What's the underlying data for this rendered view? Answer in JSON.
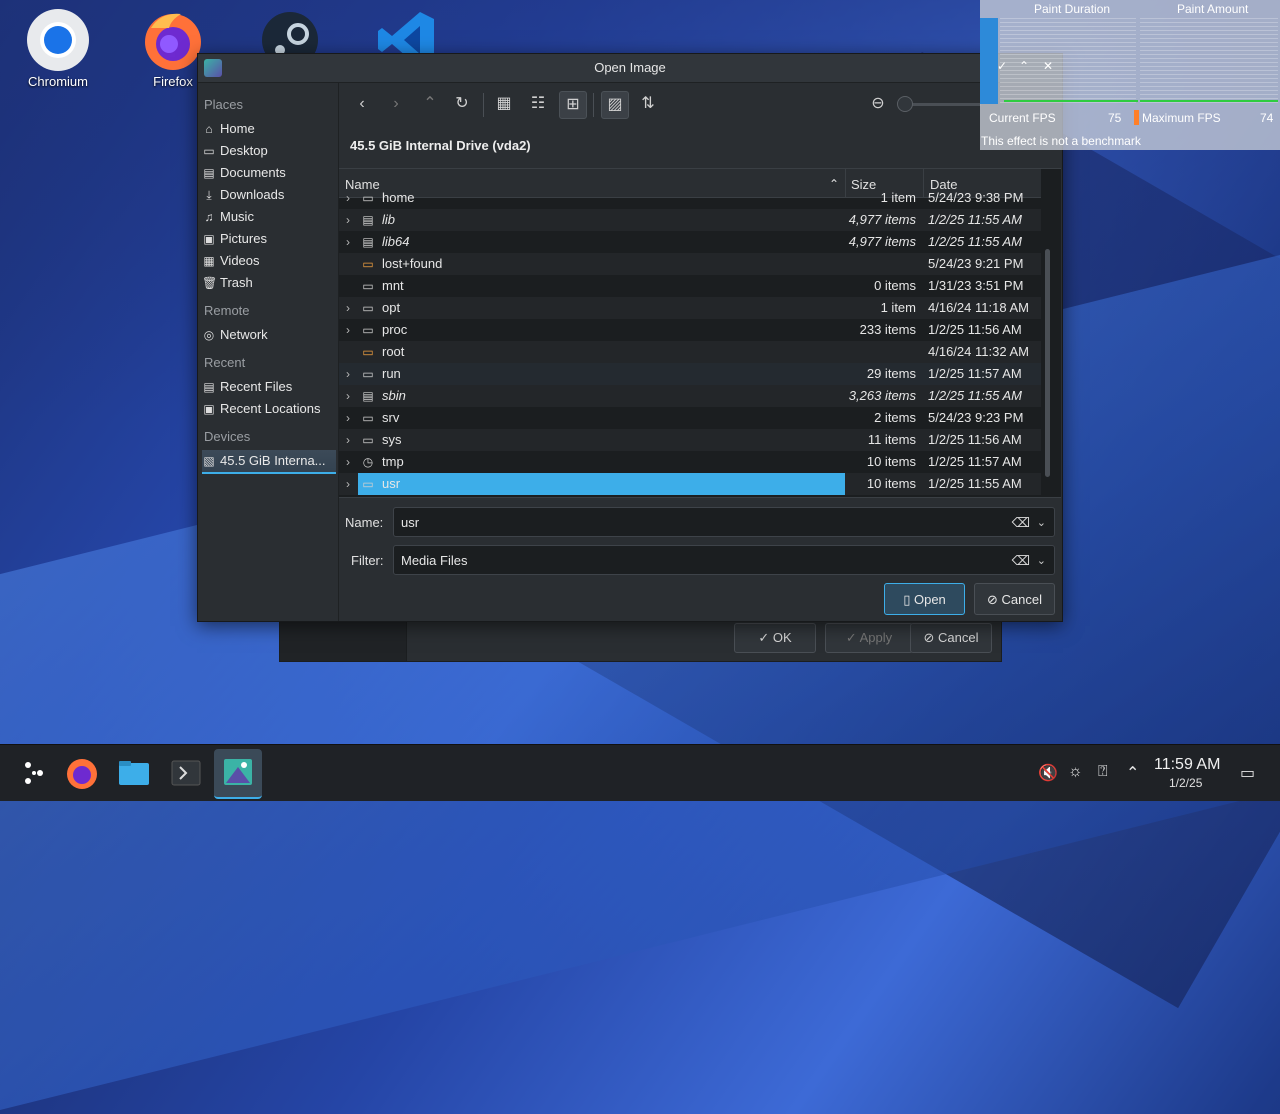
{
  "desktop": {
    "icons": [
      {
        "label": "Chromium"
      },
      {
        "label": "Firefox"
      }
    ]
  },
  "background_dialog": {
    "ok_label": "OK",
    "apply_label": "Apply",
    "cancel_label": "Cancel"
  },
  "dialog": {
    "title": "Open Image",
    "location": "45.5 GiB Internal Drive (vda2)",
    "sidebar": {
      "places_header": "Places",
      "places": [
        "Home",
        "Desktop",
        "Documents",
        "Downloads",
        "Music",
        "Pictures",
        "Videos",
        "Trash"
      ],
      "remote_header": "Remote",
      "remote": [
        "Network"
      ],
      "recent_header": "Recent",
      "recent": [
        "Recent Files",
        "Recent Locations"
      ],
      "devices_header": "Devices",
      "devices": [
        "45.5 GiB Interna..."
      ]
    },
    "columns": {
      "name": "Name",
      "size": "Size",
      "date": "Date"
    },
    "rows": [
      {
        "name": "home",
        "size": "1 item",
        "date": "5/24/23 9:38 PM"
      },
      {
        "name": "lib",
        "size": "4,977 items",
        "date": "1/2/25 11:55 AM"
      },
      {
        "name": "lib64",
        "size": "4,977 items",
        "date": "1/2/25 11:55 AM"
      },
      {
        "name": "lost+found",
        "size": "",
        "date": "5/24/23 9:21 PM"
      },
      {
        "name": "mnt",
        "size": "0 items",
        "date": "1/31/23 3:51 PM"
      },
      {
        "name": "opt",
        "size": "1 item",
        "date": "4/16/24 11:18 AM"
      },
      {
        "name": "proc",
        "size": "233 items",
        "date": "1/2/25 11:56 AM"
      },
      {
        "name": "root",
        "size": "",
        "date": "4/16/24 11:32 AM"
      },
      {
        "name": "run",
        "size": "29 items",
        "date": "1/2/25 11:57 AM"
      },
      {
        "name": "sbin",
        "size": "3,263 items",
        "date": "1/2/25 11:55 AM"
      },
      {
        "name": "srv",
        "size": "2 items",
        "date": "5/24/23 9:23 PM"
      },
      {
        "name": "sys",
        "size": "11 items",
        "date": "1/2/25 11:56 AM"
      },
      {
        "name": "tmp",
        "size": "10 items",
        "date": "1/2/25 11:57 AM"
      },
      {
        "name": "usr",
        "size": "10 items",
        "date": "1/2/25 11:55 AM"
      }
    ],
    "name_label": "Name:",
    "name_value": "usr",
    "filter_label": "Filter:",
    "filter_value": "Media Files",
    "open_label": "Open",
    "cancel_label": "Cancel"
  },
  "fps_overlay": {
    "paint_duration": "Paint Duration",
    "paint_amount": "Paint Amount",
    "current_fps_label": "Current FPS",
    "current_fps_value": "75",
    "max_fps_label": "Maximum FPS",
    "max_fps_value": "74",
    "note": "This effect is not a benchmark"
  },
  "taskbar": {
    "time": "11:59 AM",
    "date": "1/2/25"
  },
  "colors": {
    "accent": "#3daee9",
    "window_bg": "#2a2e32",
    "view_bg": "#1b1e20"
  }
}
